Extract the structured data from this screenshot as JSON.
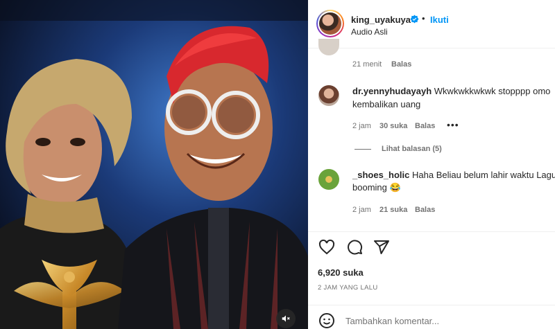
{
  "post": {
    "username": "king_uyakuya",
    "verified": true,
    "follow_label": "Ikuti",
    "separator": "•",
    "audio_label": "Audio Asli"
  },
  "media": {
    "type": "video",
    "mute_icon": "speaker-muted-icon"
  },
  "comments": [
    {
      "username": "",
      "text": "",
      "time": "21 menit",
      "likes": "",
      "reply_label": "Balas"
    },
    {
      "username": "dr.yennyhudayayh",
      "text_line1": "Wkwkwkkwkwk stopppp omo",
      "text_line2": "kembalikan uang",
      "time": "2 jam",
      "likes": "30 suka",
      "reply_label": "Balas",
      "more_label": "•••",
      "view_replies": "Lihat balasan (5)"
    },
    {
      "username": "_shoes_holic",
      "text_line1": "Haha Beliau belum lahir waktu Lagu",
      "text_line2": "booming 😂",
      "time": "2 jam",
      "likes": "21 suka",
      "reply_label": "Balas"
    }
  ],
  "actions": {
    "like_icon": "heart-icon",
    "comment_icon": "comment-icon",
    "share_icon": "share-icon"
  },
  "likes_count": "6,920 suka",
  "posted_time": "2 JAM YANG LALU",
  "add_comment": {
    "placeholder": "Tambahkan komentar..."
  },
  "colors": {
    "accent": "#0095f6",
    "muted": "#737373",
    "text": "#262626"
  }
}
